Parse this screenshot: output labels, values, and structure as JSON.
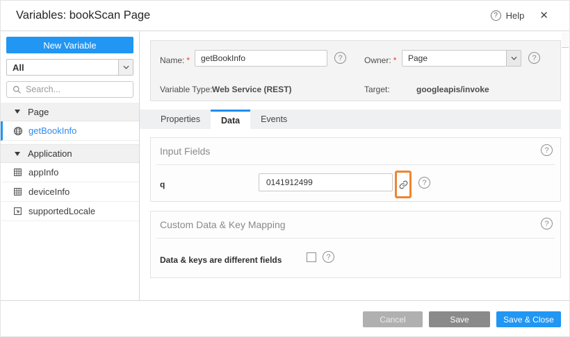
{
  "header": {
    "title": "Variables: bookScan Page",
    "help_label": "Help"
  },
  "icons": {
    "question_glyph": "?",
    "close_glyph": "✕"
  },
  "sidebar": {
    "new_variable_label": "New Variable",
    "filter_value": "All",
    "search_placeholder": "Search...",
    "tree": [
      {
        "type": "group",
        "label": "Page"
      },
      {
        "type": "item",
        "label": "getBookInfo",
        "icon": "web-service-globe-icon",
        "selected": true
      },
      {
        "type": "group",
        "label": "Application"
      },
      {
        "type": "item",
        "label": "appInfo",
        "icon": "grid-variable-icon",
        "selected": false
      },
      {
        "type": "item",
        "label": "deviceInfo",
        "icon": "grid-variable-icon",
        "selected": false
      },
      {
        "type": "item",
        "label": "supportedLocale",
        "icon": "locale-square-icon",
        "selected": false
      }
    ]
  },
  "summary": {
    "name_label": "Name:",
    "name_value": "getBookInfo",
    "owner_label": "Owner:",
    "owner_value": "Page",
    "variable_type_label": "Variable Type:",
    "variable_type_value": "Web Service (REST)",
    "target_label": "Target:",
    "target_value": "googleapis/invoke",
    "required_marker": "*"
  },
  "tabs": [
    {
      "label": "Properties",
      "active": false
    },
    {
      "label": "Data",
      "active": true
    },
    {
      "label": "Events",
      "active": false
    }
  ],
  "sections": {
    "input_fields": {
      "title": "Input Fields",
      "field_label": "q",
      "field_value": "0141912499"
    },
    "custom_mapping": {
      "title": "Custom Data & Key Mapping",
      "checkbox_label": "Data & keys are different fields",
      "checkbox_checked": false
    }
  },
  "footer": {
    "cancel_label": "Cancel",
    "save_label": "Save",
    "save_close_label": "Save & Close"
  },
  "colors": {
    "accent": "#2196f3",
    "highlight_box": "#ef8430",
    "save_gray": "#8a8a8a",
    "cancel_gray": "#b0b0b0"
  }
}
